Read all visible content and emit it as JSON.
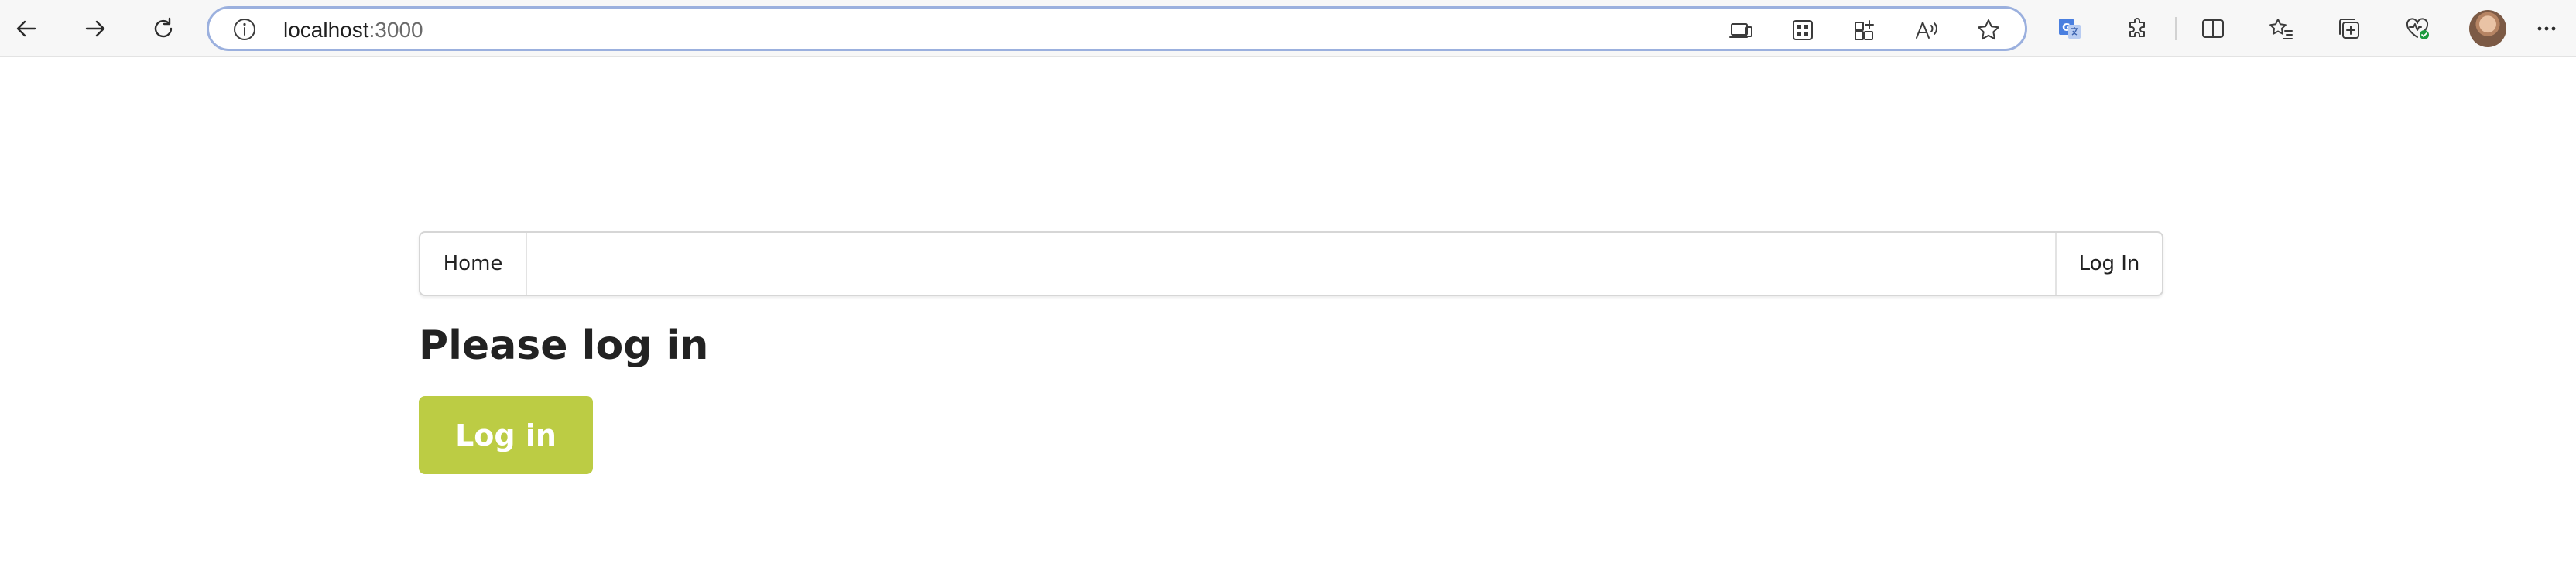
{
  "browser": {
    "url_host": "localhost",
    "url_port": ":3000",
    "icons": {
      "back": "back-arrow-icon",
      "forward": "forward-arrow-icon",
      "refresh": "refresh-icon",
      "site_info": "info-icon",
      "cast": "device-cast-icon",
      "apps": "apps-grid-icon",
      "app_available": "app-available-icon",
      "read_aloud": "read-aloud-icon",
      "favorite": "star-icon",
      "translate": "translate-icon",
      "extensions": "puzzle-icon",
      "split_screen": "split-screen-icon",
      "favorites_list": "favorites-list-icon",
      "collections": "collections-icon",
      "browser_essentials": "heart-pulse-icon",
      "more": "more-icon"
    },
    "colors": {
      "address_border": "#9bb0de",
      "translate_blue": "#4a7fe0",
      "essentials_green": "#1c9b3f"
    }
  },
  "navbar": {
    "home_label": "Home",
    "login_label": "Log In"
  },
  "main": {
    "title": "Please log in",
    "login_button_label": "Log in",
    "button_color": "#bccc44"
  }
}
